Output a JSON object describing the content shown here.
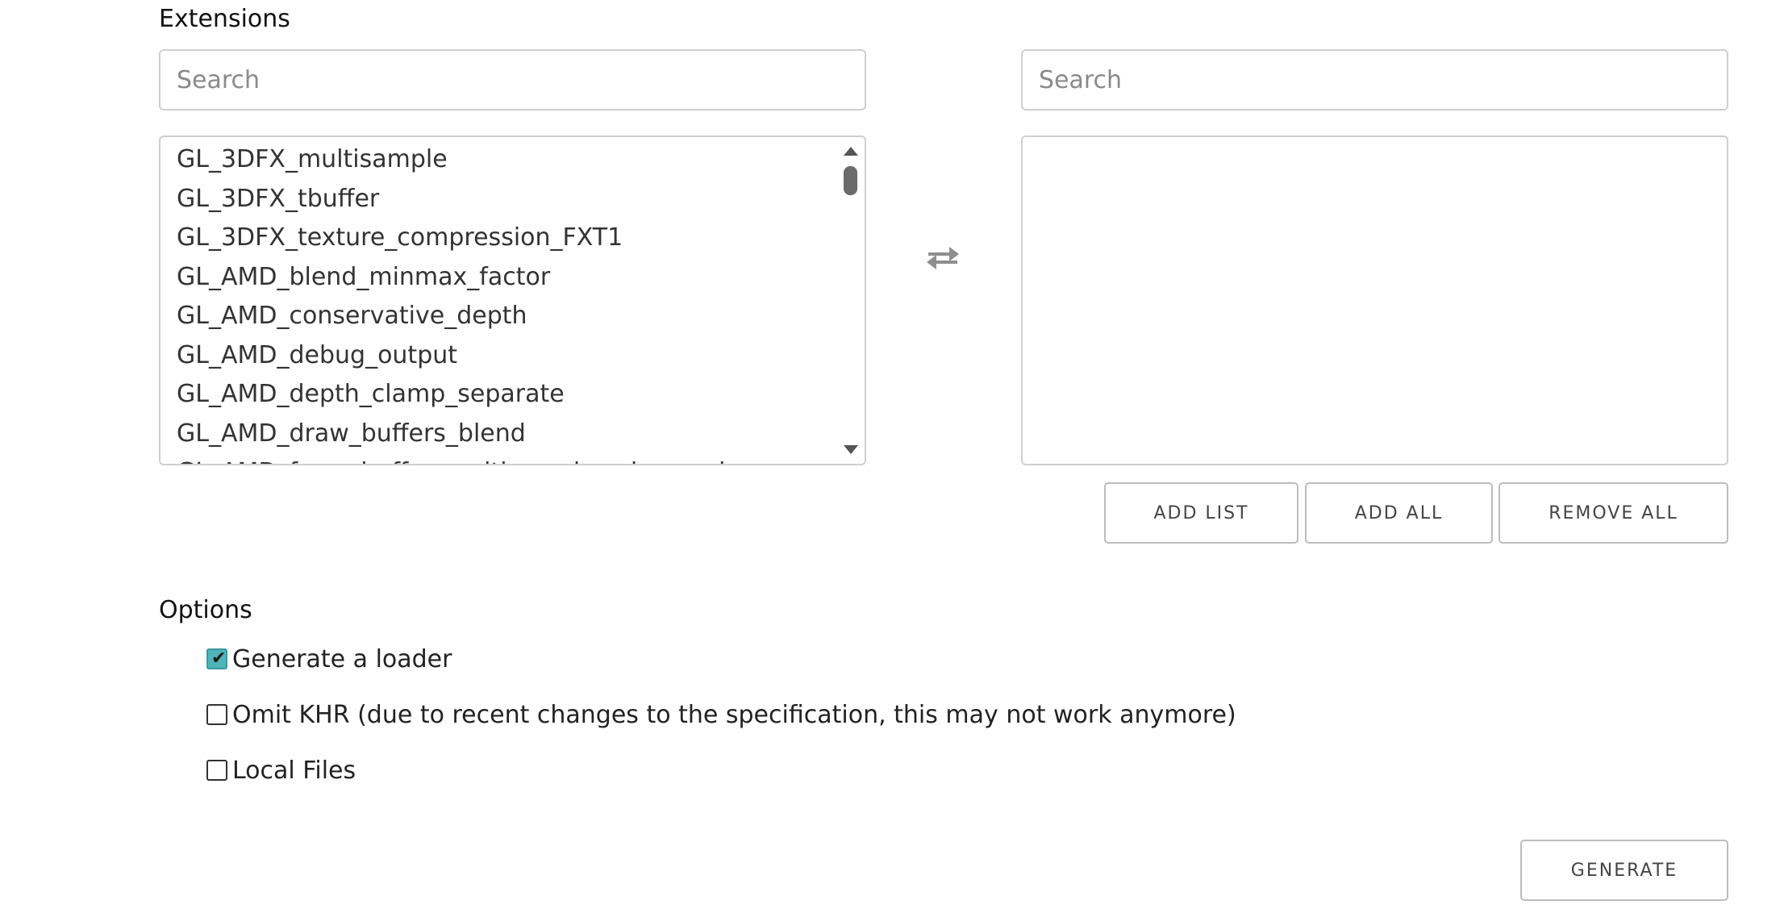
{
  "extensions": {
    "title": "Extensions",
    "left_search": {
      "placeholder": "Search",
      "value": ""
    },
    "right_search": {
      "placeholder": "Search",
      "value": ""
    },
    "available_items": [
      "GL_3DFX_multisample",
      "GL_3DFX_tbuffer",
      "GL_3DFX_texture_compression_FXT1",
      "GL_AMD_blend_minmax_factor",
      "GL_AMD_conservative_depth",
      "GL_AMD_debug_output",
      "GL_AMD_depth_clamp_separate",
      "GL_AMD_draw_buffers_blend",
      "GL_AMD_framebuffer_multisample_advanced"
    ],
    "selected_items": [],
    "swap_icon": "swap-arrows-icon",
    "buttons": {
      "add_list": "ADD LIST",
      "add_all": "ADD ALL",
      "remove_all": "REMOVE ALL"
    }
  },
  "options": {
    "title": "Options",
    "items": [
      {
        "label": "Generate a loader",
        "checked": true
      },
      {
        "label": "Omit KHR (due to recent changes to the specification, this may not work anymore)",
        "checked": false
      },
      {
        "label": "Local Files",
        "checked": false
      }
    ],
    "check_color": "#4fb3b8"
  },
  "generate_label": "GENERATE"
}
